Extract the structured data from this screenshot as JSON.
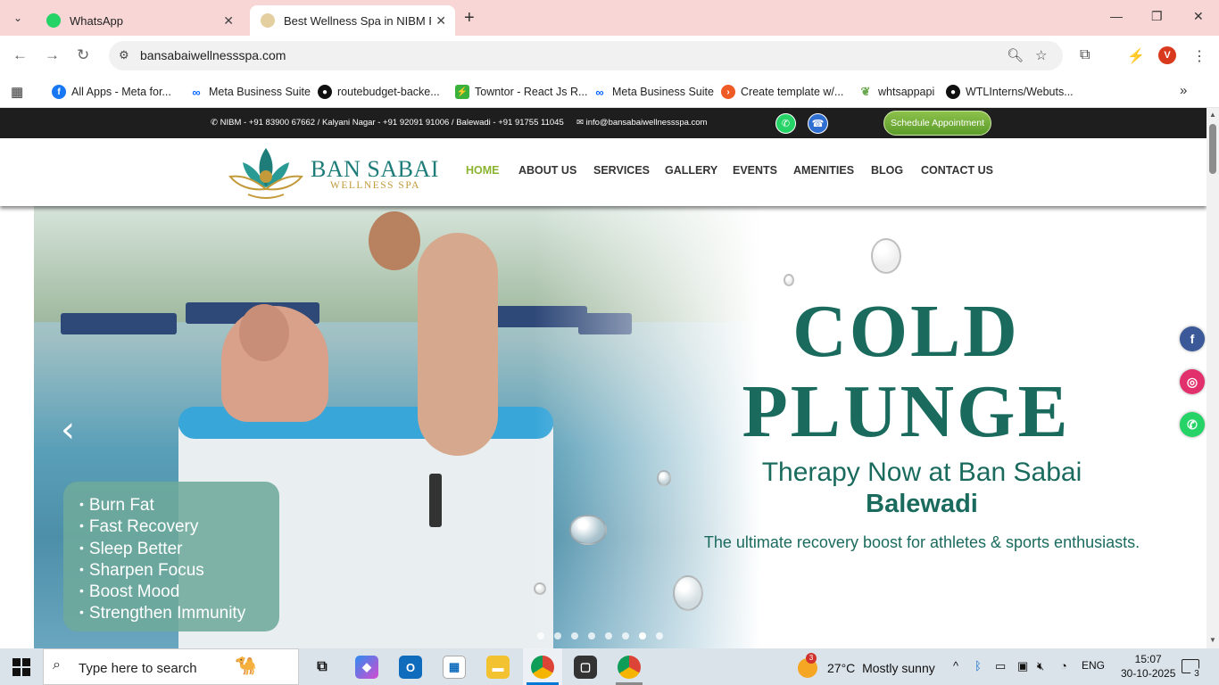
{
  "browser": {
    "tabs": [
      {
        "title": "WhatsApp",
        "icon": "whatsapp-icon"
      },
      {
        "title": "Best Wellness Spa in NIBM Road",
        "icon": "lotus-icon"
      }
    ],
    "url": "bansabaiwellnessspa.com",
    "profile_initial": "V"
  },
  "bookmarks": [
    {
      "label": "All Apps - Meta for...",
      "icon": "facebook-icon",
      "color": "#1877f2"
    },
    {
      "label": "Meta Business Suite",
      "icon": "meta-icon",
      "color": "#0866ff"
    },
    {
      "label": "routebudget-backe...",
      "icon": "github-icon",
      "color": "#111111"
    },
    {
      "label": "Towntor - React Js R...",
      "icon": "towntor-icon",
      "color": "#38b23a"
    },
    {
      "label": "Meta Business Suite",
      "icon": "meta-icon",
      "color": "#0866ff"
    },
    {
      "label": "Create template w/...",
      "icon": "postman-icon",
      "color": "#ef5b25"
    },
    {
      "label": "whtsappapi",
      "icon": "leaf-icon",
      "color": "#6aa84f"
    },
    {
      "label": "WTLInterns/Webuts...",
      "icon": "github-icon",
      "color": "#111111"
    }
  ],
  "site": {
    "topbar": {
      "contact": "NIBM - +91 83900 67662 / Kalyani Nagar - +91 92091 91006 / Balewadi - +91 91755 11045",
      "email": "info@bansabaiwellnessspa.com",
      "schedule_label": "Schedule Appointment"
    },
    "brand": {
      "name": "BAN SABAI",
      "sub": "WELLNESS SPA"
    },
    "menu": [
      "HOME",
      "ABOUT US",
      "SERVICES",
      "GALLERY",
      "EVENTS",
      "AMENITIES",
      "BLOG",
      "CONTACT US"
    ],
    "active_menu": "HOME",
    "hero": {
      "benefits": [
        "Burn Fat",
        "Fast Recovery",
        "Sleep Better",
        "Sharpen Focus",
        "Boost Mood",
        "Strengthen Immunity"
      ],
      "headline_1": "COLD",
      "headline_2": "PLUNGE",
      "subheadline": "Therapy Now at Ban Sabai",
      "location": "Balewadi",
      "description": "The ultimate recovery boost for athletes & sports enthusiasts.",
      "slide_count": 8,
      "active_slide": 7
    },
    "social": [
      {
        "icon": "facebook-icon",
        "color": "#3b5998"
      },
      {
        "icon": "instagram-icon",
        "color": "#e1306c"
      },
      {
        "icon": "whatsapp-icon",
        "color": "#25d366"
      }
    ],
    "colors": {
      "brand_teal": "#1a6b5e",
      "menu_active": "#8ab430",
      "topbar": "#1e1e1e"
    }
  },
  "taskbar": {
    "search_placeholder": "Type here to search",
    "weather_temp": "27°C",
    "weather_text": "Mostly sunny",
    "weather_badge": "3",
    "language": "ENG",
    "time": "15:07",
    "date": "30-10-2025",
    "notification_count": "3"
  }
}
